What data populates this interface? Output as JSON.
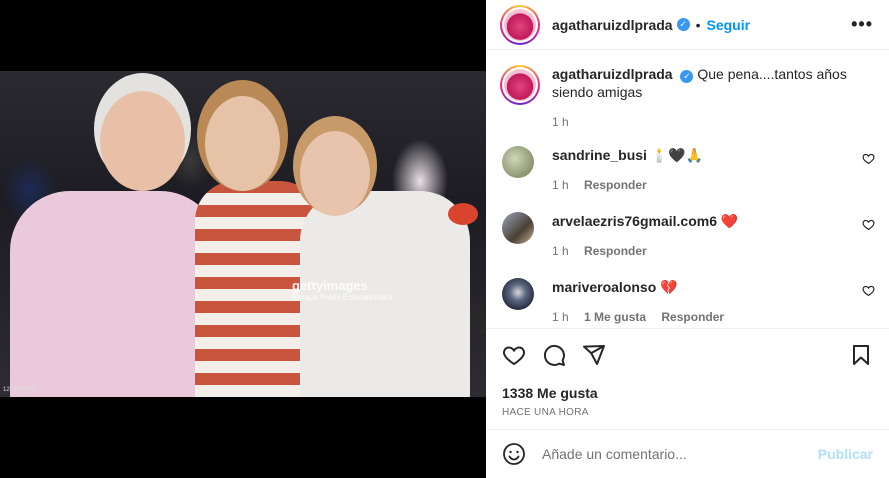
{
  "post": {
    "username": "agatharuizdlprada",
    "follow_label": "Seguir",
    "separator": "•",
    "more_label": "•••",
    "verified_glyph": "✓"
  },
  "photo": {
    "watermark_brand": "gettyimages",
    "watermark_sub": "Europa Press Entertainment",
    "photo_id": "1203206660"
  },
  "caption": {
    "username": "agatharuizdlprada",
    "text": "Que pena....tantos años siendo amigas",
    "time": "1 h"
  },
  "comments": [
    {
      "username": "sandrine_busi",
      "text": "🕯️🖤🙏",
      "time": "1 h",
      "likes": "",
      "reply": "Responder",
      "avatar_color": "#8a8a6a"
    },
    {
      "username": "arvelaezris76gmail.com6",
      "text": "❤️",
      "time": "1 h",
      "likes": "",
      "reply": "Responder",
      "avatar_color": "#6b5a48"
    },
    {
      "username": "mariveroalonso",
      "text": "💔",
      "time": "1 h",
      "likes": "1 Me gusta",
      "reply": "Responder",
      "avatar_color": "#3a4a6a"
    }
  ],
  "actions": {
    "likes_count": "1338 Me gusta",
    "time_ago": "HACE UNA HORA"
  },
  "add_comment": {
    "placeholder": "Añade un comentario...",
    "publish_label": "Publicar"
  },
  "colors": {
    "accent": "#0095f6",
    "verified": "#3897f0",
    "publish_disabled": "#b2dffc"
  },
  "icons": {
    "like": "heart-icon",
    "comment": "comment-icon",
    "share": "send-icon",
    "save": "bookmark-icon",
    "emoji": "smiley-icon",
    "more": "more-options-icon"
  }
}
